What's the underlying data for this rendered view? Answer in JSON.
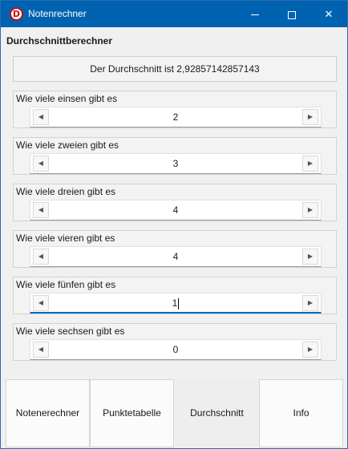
{
  "window": {
    "title": "Notenrechner",
    "icon_letter": "D"
  },
  "heading": "Durchschnittberechner",
  "result_text": "Der Durchschnitt ist 2,92857142857143",
  "groups": [
    {
      "label": "Wie viele einsen gibt es",
      "value": "2"
    },
    {
      "label": "Wie viele zweien gibt es",
      "value": "3"
    },
    {
      "label": "Wie viele dreien gibt es",
      "value": "4"
    },
    {
      "label": "Wie viele vieren gibt es",
      "value": "4"
    },
    {
      "label": "Wie viele fünfen gibt es",
      "value": "1"
    },
    {
      "label": "Wie viele sechsen gibt es",
      "value": "0"
    }
  ],
  "tabs": [
    {
      "label": "Notenerechner"
    },
    {
      "label": "Punktetabelle"
    },
    {
      "label": "Durchschnitt"
    },
    {
      "label": "Info"
    }
  ],
  "colors": {
    "titlebar": "#0063b1",
    "focus": "#0067c0"
  },
  "icons": {
    "app": "app-icon",
    "spinner_left": "arrow-left-icon",
    "spinner_right": "arrow-right-icon"
  }
}
